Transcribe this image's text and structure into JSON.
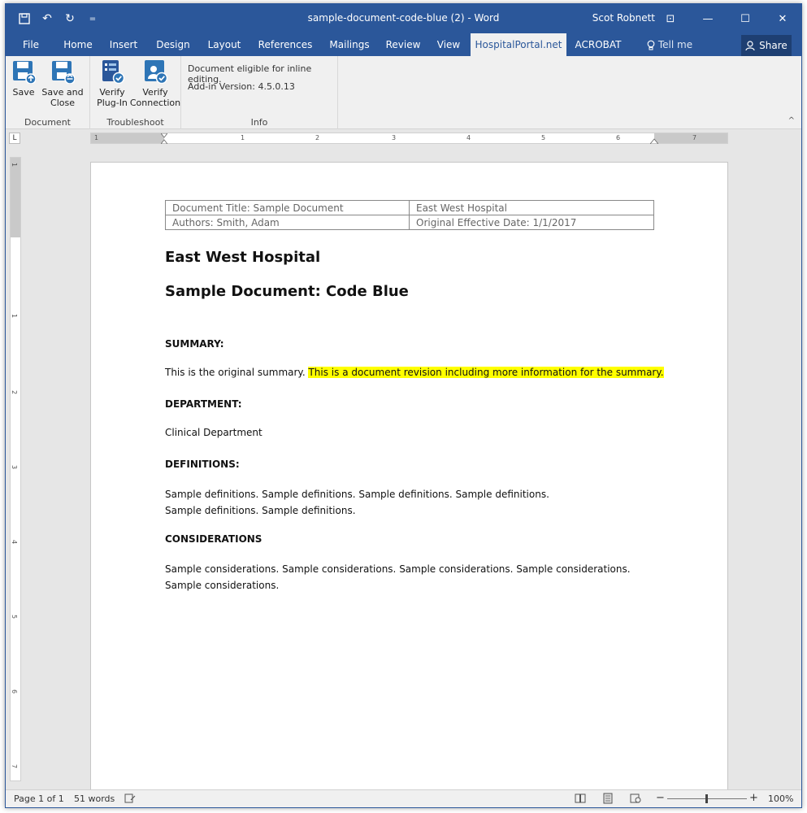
{
  "window": {
    "doc_title": "sample-document-code-blue (2)  -  Word",
    "user": "Scot Robnett",
    "qat": {
      "save_icon": "save-icon",
      "undo_glyph": "↶",
      "redo_glyph": "↻",
      "customize_glyph": "="
    },
    "controls": {
      "ribbon_display_glyph": "⊡",
      "minimize_glyph": "—",
      "maximize_glyph": "☐",
      "close_glyph": "✕"
    }
  },
  "tabs": [
    {
      "label": "File"
    },
    {
      "label": "Home"
    },
    {
      "label": "Insert"
    },
    {
      "label": "Design"
    },
    {
      "label": "Layout"
    },
    {
      "label": "References"
    },
    {
      "label": "Mailings"
    },
    {
      "label": "Review"
    },
    {
      "label": "View"
    },
    {
      "label": "HospitalPortal.net"
    },
    {
      "label": "ACROBAT"
    },
    {
      "label": "Tell me"
    }
  ],
  "share": {
    "label": "Share"
  },
  "ribbon": {
    "groups": {
      "document": "Document",
      "troubleshoot": "Troubleshoot",
      "info": "Info"
    },
    "buttons": {
      "save": "Save",
      "save_close_1": "Save and",
      "save_close_2": "Close",
      "verify_plugin_1": "Verify",
      "verify_plugin_2": "Plug-In",
      "verify_conn_1": "Verify",
      "verify_conn_2": "Connection"
    },
    "info": {
      "line1": "Document eligible for inline editing.",
      "line2": "Add-in Version: 4.5.0.13"
    },
    "collapse_glyph": "^"
  },
  "ruler": {
    "corner": "L",
    "h_numbers": [
      "1",
      "1",
      "2",
      "3",
      "4",
      "5",
      "6",
      "7"
    ],
    "v_numbers": [
      "1",
      "1",
      "2",
      "3",
      "4",
      "5",
      "6",
      "7"
    ]
  },
  "document": {
    "header_table": [
      [
        "Document Title: Sample Document",
        "East West Hospital"
      ],
      [
        "Authors: Smith, Adam",
        "Original Effective Date: 1/1/2017"
      ]
    ],
    "heading1": "East West Hospital",
    "heading2": "Sample Document: Code Blue",
    "summary_head": "SUMMARY:",
    "summary_text": "This is the original summary. ",
    "summary_highlight": "This is a document revision including more information for the summary.",
    "department_head": "DEPARTMENT:",
    "department_text": "Clinical Department",
    "definitions_head": "DEFINITIONS:",
    "definitions_line1": "Sample definitions.  Sample definitions.  Sample definitions. Sample definitions.",
    "definitions_line2": "Sample definitions. Sample definitions.",
    "considerations_head": "CONSIDERATIONS",
    "considerations_line1": "Sample considerations. Sample considerations. Sample considerations. Sample considerations.",
    "considerations_line2": "Sample considerations."
  },
  "status": {
    "page": "Page 1 of 1",
    "words": "51 words",
    "zoom": "100%",
    "zoom_minus": "−",
    "zoom_plus": "+"
  },
  "colors": {
    "accent": "#2b579a",
    "highlight": "#ffff00"
  }
}
